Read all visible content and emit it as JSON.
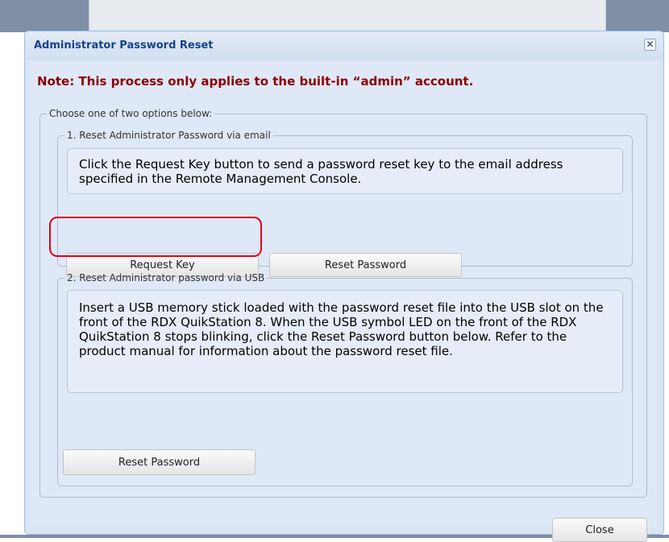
{
  "dialog": {
    "title": "Administrator Password Reset",
    "close_glyph": "✕"
  },
  "note": "Note: This process only applies to the built-in “admin” account.",
  "options_legend": "Choose one of two options below:",
  "option1": {
    "legend": "1. Reset Administrator Password via email",
    "info": "Click the Request Key button to send a password reset key to the email address specified in the Remote Management Console.",
    "request_key_label": "Request Key",
    "reset_password_label": "Reset Password"
  },
  "option2": {
    "legend": "2. Reset Administrator password via USB",
    "info": "Insert a USB memory stick loaded with the password reset file into the USB slot on the front of the RDX QuikStation 8. When the USB symbol LED on the front of the RDX QuikStation 8 stops blinking, click the Reset Password button below. Refer to the product manual for information about the password reset file.",
    "reset_password_label": "Reset Password"
  },
  "close_label": "Close",
  "colors": {
    "title_text": "#15428b",
    "note_text": "#8b0000",
    "highlight": "#e0001a",
    "dialog_bg": "#dfe8f6"
  }
}
